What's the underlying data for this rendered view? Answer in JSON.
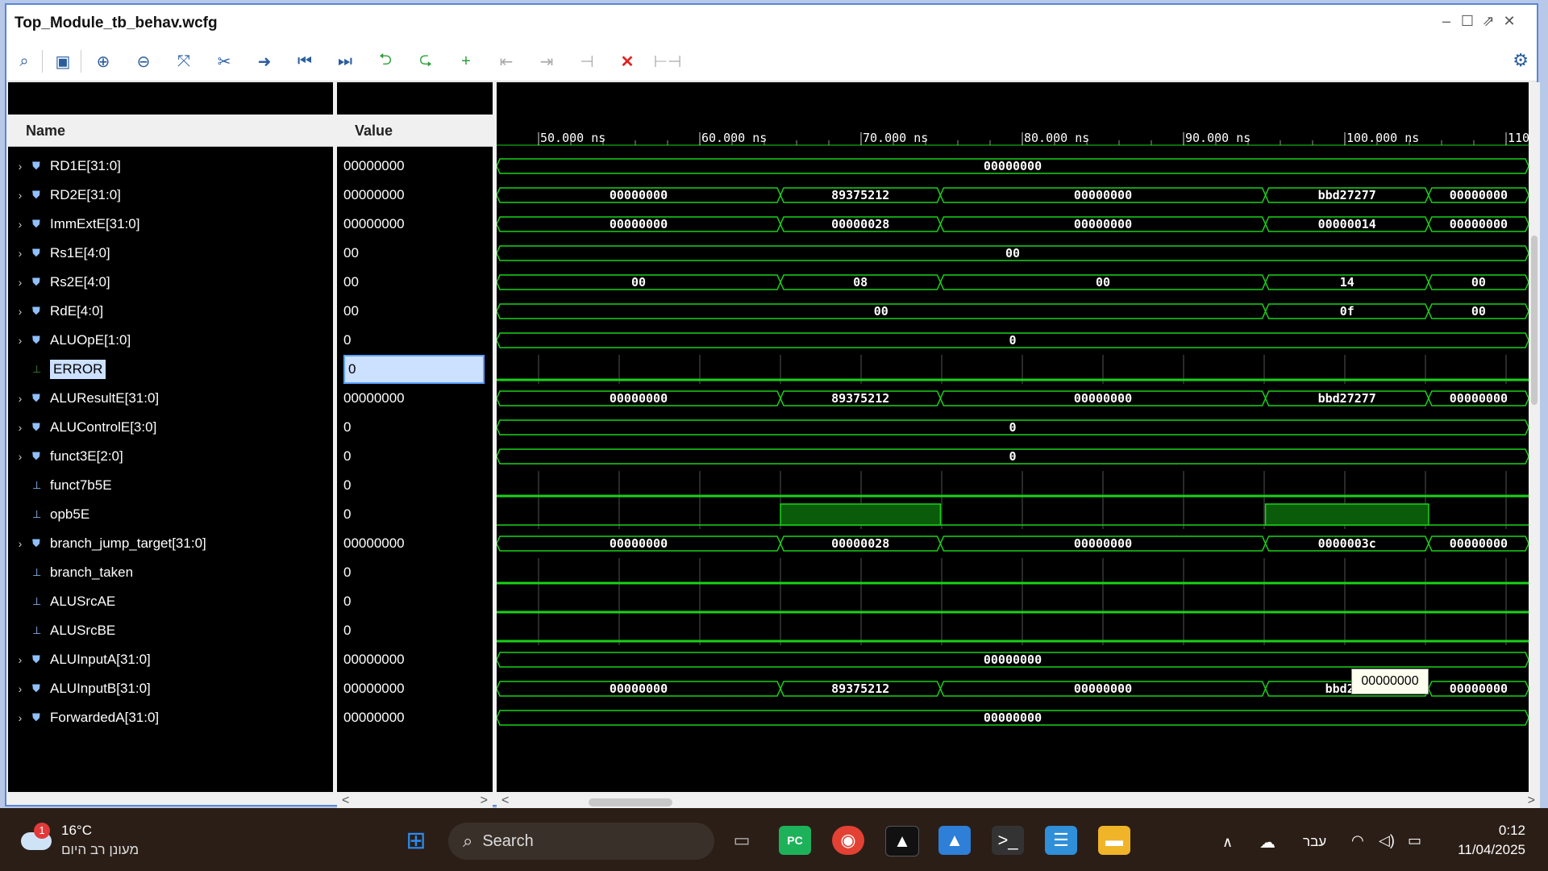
{
  "window": {
    "title": "Top_Module_tb_behav.wcfg"
  },
  "toolbar": {
    "icons": [
      "search-icon",
      "save-icon",
      "zoom-in-icon",
      "zoom-out-icon",
      "zoom-fit-icon",
      "cursor-icon",
      "go-to-cursor-icon",
      "go-to-start-icon",
      "go-to-end-icon",
      "previous-transition-icon",
      "next-transition-icon",
      "add-marker-icon",
      "previous-marker-icon",
      "next-marker-icon",
      "swap-cursors-icon",
      "delete-icon",
      "snap-icon"
    ]
  },
  "headers": {
    "name": "Name",
    "value": "Value"
  },
  "timeline": [
    "50.000 ns",
    "60.000 ns",
    "70.000 ns",
    "80.000 ns",
    "90.000 ns",
    "100.000 ns",
    "110"
  ],
  "signals": [
    {
      "name": "RD1E[31:0]",
      "value": "00000000",
      "bus": true
    },
    {
      "name": "RD2E[31:0]",
      "value": "00000000",
      "bus": true
    },
    {
      "name": "ImmExtE[31:0]",
      "value": "00000000",
      "bus": true
    },
    {
      "name": "Rs1E[4:0]",
      "value": "00",
      "bus": true
    },
    {
      "name": "Rs2E[4:0]",
      "value": "00",
      "bus": true
    },
    {
      "name": "RdE[4:0]",
      "value": "00",
      "bus": true
    },
    {
      "name": "ALUOpE[1:0]",
      "value": "0",
      "bus": true
    },
    {
      "name": "ERROR",
      "value": "0",
      "bus": false
    },
    {
      "name": "ALUResultE[31:0]",
      "value": "00000000",
      "bus": true
    },
    {
      "name": "ALUControlE[3:0]",
      "value": "0",
      "bus": true
    },
    {
      "name": "funct3E[2:0]",
      "value": "0",
      "bus": true
    },
    {
      "name": "funct7b5E",
      "value": "0",
      "bus": false
    },
    {
      "name": "opb5E",
      "value": "0",
      "bus": false
    },
    {
      "name": "branch_jump_target[31:0]",
      "value": "00000000",
      "bus": true
    },
    {
      "name": "branch_taken",
      "value": "0",
      "bus": false
    },
    {
      "name": "ALUSrcAE",
      "value": "0",
      "bus": false
    },
    {
      "name": "ALUSrcBE",
      "value": "0",
      "bus": false
    },
    {
      "name": "ALUInputA[31:0]",
      "value": "00000000",
      "bus": true
    },
    {
      "name": "ALUInputB[31:0]",
      "value": "00000000",
      "bus": true
    },
    {
      "name": "ForwardedA[31:0]",
      "value": "00000000",
      "bus": true
    }
  ],
  "waves": [
    {
      "type": "bus",
      "segs": [
        [
          "00000000",
          0,
          1
        ]
      ]
    },
    {
      "type": "bus",
      "segs": [
        [
          "00000000",
          0,
          0.275
        ],
        [
          "89375212",
          0.275,
          0.43
        ],
        [
          "00000000",
          0.43,
          0.745
        ],
        [
          "bbd27277",
          0.745,
          0.903
        ],
        [
          "00000000",
          0.903,
          1
        ]
      ]
    },
    {
      "type": "bus",
      "segs": [
        [
          "00000000",
          0,
          0.275
        ],
        [
          "00000028",
          0.275,
          0.43
        ],
        [
          "00000000",
          0.43,
          0.745
        ],
        [
          "00000014",
          0.745,
          0.903
        ],
        [
          "00000000",
          0.903,
          1
        ]
      ]
    },
    {
      "type": "bus",
      "segs": [
        [
          "00",
          0,
          1
        ]
      ]
    },
    {
      "type": "bus",
      "segs": [
        [
          "00",
          0,
          0.275
        ],
        [
          "08",
          0.275,
          0.43
        ],
        [
          "00",
          0.43,
          0.745
        ],
        [
          "14",
          0.745,
          0.903
        ],
        [
          "00",
          0.903,
          1
        ]
      ]
    },
    {
      "type": "bus",
      "segs": [
        [
          "00",
          0,
          0.745
        ],
        [
          "0f",
          0.745,
          0.903
        ],
        [
          "00",
          0.903,
          1
        ]
      ]
    },
    {
      "type": "bus",
      "segs": [
        [
          "0",
          0,
          1
        ]
      ]
    },
    {
      "type": "bit",
      "highs": []
    },
    {
      "type": "bus",
      "segs": [
        [
          "00000000",
          0,
          0.275
        ],
        [
          "89375212",
          0.275,
          0.43
        ],
        [
          "00000000",
          0.43,
          0.745
        ],
        [
          "bbd27277",
          0.745,
          0.903
        ],
        [
          "00000000",
          0.903,
          1
        ]
      ]
    },
    {
      "type": "bus",
      "segs": [
        [
          "0",
          0,
          1
        ]
      ]
    },
    {
      "type": "bus",
      "segs": [
        [
          "0",
          0,
          1
        ]
      ]
    },
    {
      "type": "bit",
      "highs": []
    },
    {
      "type": "bit",
      "highs": [
        [
          0.275,
          0.43
        ],
        [
          0.745,
          0.903
        ]
      ]
    },
    {
      "type": "bus",
      "segs": [
        [
          "00000000",
          0,
          0.275
        ],
        [
          "00000028",
          0.275,
          0.43
        ],
        [
          "00000000",
          0.43,
          0.745
        ],
        [
          "0000003c",
          0.745,
          0.903
        ],
        [
          "00000000",
          0.903,
          1
        ]
      ]
    },
    {
      "type": "bit",
      "highs": []
    },
    {
      "type": "bit",
      "highs": []
    },
    {
      "type": "bit",
      "highs": []
    },
    {
      "type": "bus",
      "segs": [
        [
          "00000000",
          0,
          1
        ]
      ]
    },
    {
      "type": "bus",
      "segs": [
        [
          "00000000",
          0,
          0.275
        ],
        [
          "89375212",
          0.275,
          0.43
        ],
        [
          "00000000",
          0.43,
          0.745
        ],
        [
          "bbd272",
          0.745,
          0.903
        ],
        [
          "00000000",
          0.903,
          1
        ]
      ]
    },
    {
      "type": "bus",
      "segs": [
        [
          "00000000",
          0,
          1
        ]
      ]
    }
  ],
  "tooltip": "00000000",
  "taskbar": {
    "weather_temp": "16°C",
    "weather_desc": "מעונן רב היום",
    "weather_badge": "1",
    "search_label": "Search",
    "lang": "עבר",
    "time": "0:12",
    "date": "11/04/2025"
  },
  "colors": {
    "wave": "#19d219",
    "bg": "#000000",
    "accent": "#2a5d9e"
  }
}
